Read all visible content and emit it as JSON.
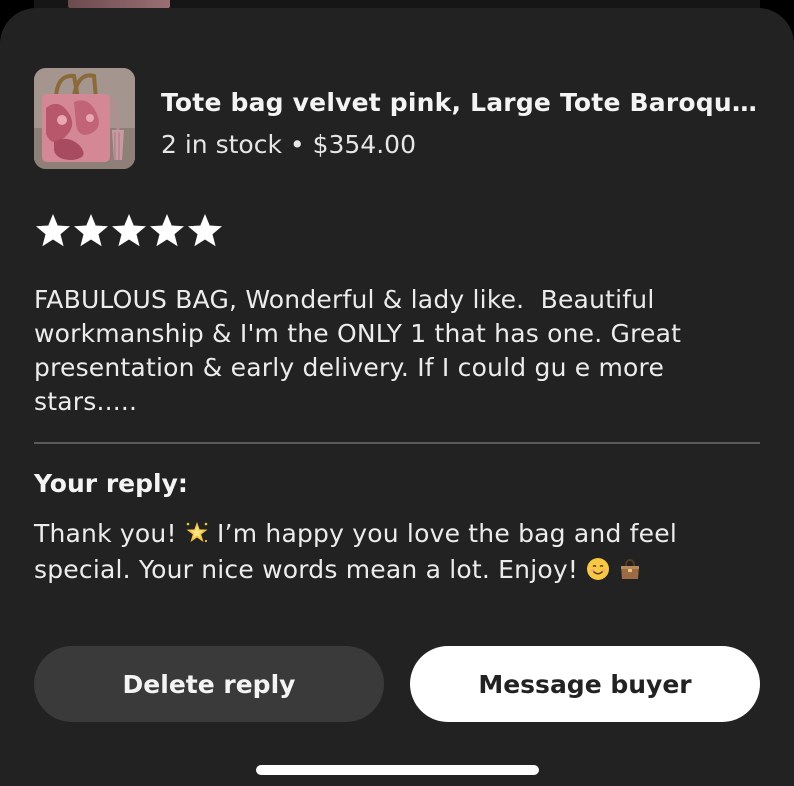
{
  "product": {
    "title": "Tote bag velvet pink, Large Tote Baroque b...",
    "stock": "2 in stock",
    "separator": "•",
    "price": "$354.00",
    "thumbnail_icon": "pink-velvet-tote-bag-photo"
  },
  "review": {
    "rating": 5,
    "max_rating": 5,
    "star_color": "#ffffff",
    "text": "FABULOUS BAG, Wonderful & lady like.  Beautiful\nworkmanship & I'm the ONLY 1 that has one. Great\npresentation & early delivery. If I could gu e more\nstars....."
  },
  "reply": {
    "heading": "Your reply:",
    "part1": "Thank you!",
    "part2": "I’m happy you love the bag and feel special. Your nice words mean a lot. Enjoy!",
    "emoji_icons": [
      "sparkle-star-icon",
      "smiling-face-icon",
      "handbag-icon"
    ]
  },
  "actions": {
    "delete_label": "Delete reply",
    "message_label": "Message buyer"
  },
  "colors": {
    "sheet_background": "#222222",
    "secondary_button": "#3a3a3a",
    "primary_button": "#ffffff"
  }
}
